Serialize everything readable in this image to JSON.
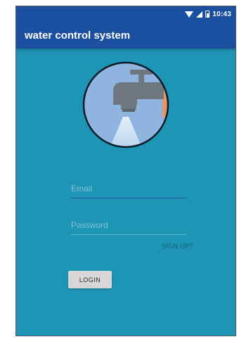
{
  "status_bar": {
    "time": "10:43",
    "icons": [
      "wifi-icon",
      "signal-icon",
      "battery-icon"
    ]
  },
  "app_bar": {
    "title": "water control system"
  },
  "logo": {
    "icon": "water-tap-icon"
  },
  "form": {
    "email_placeholder": "Email",
    "email_value": "",
    "password_placeholder": "Password",
    "password_value": "",
    "signup_label": "SIGN UP?",
    "login_label": "LOGIN"
  },
  "colors": {
    "app_bar": "#1b4fa0",
    "background": "#1f95b6",
    "logo_circle": "#8fb4e0",
    "tap": "#6f7880",
    "button": "#d7d7d7"
  }
}
